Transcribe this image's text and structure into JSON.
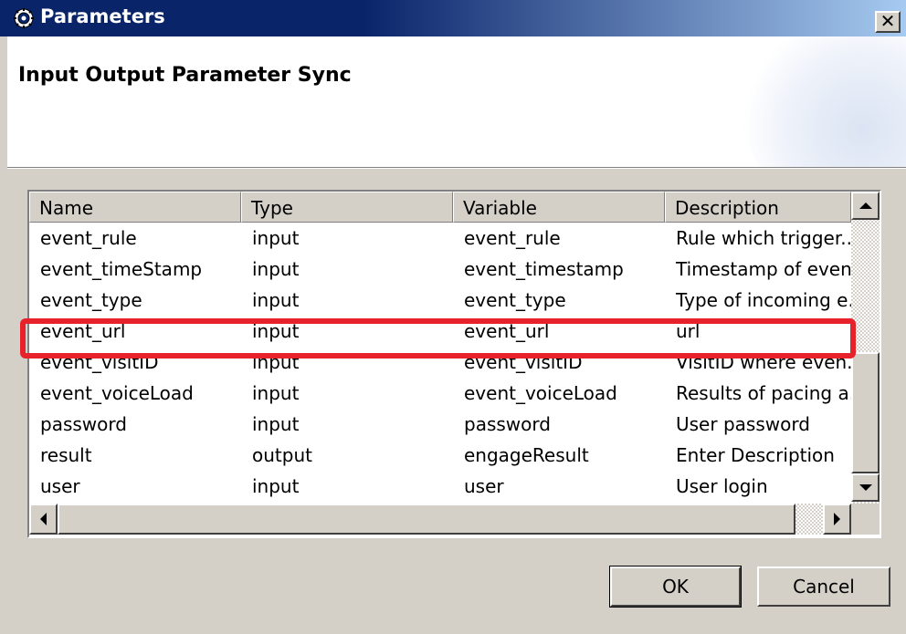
{
  "window": {
    "title": "Parameters",
    "close_label": "✕"
  },
  "banner": {
    "title": "Input Output Parameter Sync"
  },
  "table": {
    "columns": [
      "Name",
      "Type",
      "Variable",
      "Description"
    ],
    "rows": [
      {
        "name": "event_rule",
        "type": "input",
        "variable": "event_rule",
        "description": "Rule which trigger..."
      },
      {
        "name": "event_timeStamp",
        "type": "input",
        "variable": "event_timestamp",
        "description": "Timestamp of even.."
      },
      {
        "name": "event_type",
        "type": "input",
        "variable": "event_type",
        "description": "Type of incoming e.."
      },
      {
        "name": "event_url",
        "type": "input",
        "variable": "event_url",
        "description": "url"
      },
      {
        "name": "event_visitID",
        "type": "input",
        "variable": "event_visitID",
        "description": "VisitID where even.."
      },
      {
        "name": "event_voiceLoad",
        "type": "input",
        "variable": "event_voiceLoad",
        "description": "Results of pacing a.."
      },
      {
        "name": "password",
        "type": "input",
        "variable": "password",
        "description": "User password"
      },
      {
        "name": "result",
        "type": "output",
        "variable": "engageResult",
        "description": "Enter Description"
      },
      {
        "name": "user",
        "type": "input",
        "variable": "user",
        "description": "User login"
      }
    ],
    "highlighted_row": "event_url"
  },
  "buttons": {
    "ok": "OK",
    "cancel": "Cancel"
  },
  "colors": {
    "titlebar": "#0a246a",
    "dialog_bg": "#d4d0c8",
    "highlight": "#e8222b"
  },
  "icons": {
    "title": "gear-icon",
    "close": "close-icon"
  }
}
